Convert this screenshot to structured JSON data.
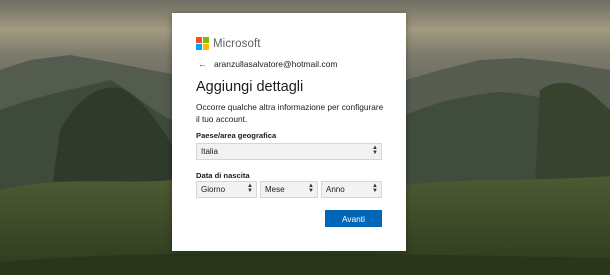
{
  "brand": {
    "name": "Microsoft",
    "colors": {
      "red": "#f25022",
      "green": "#7fba00",
      "blue": "#00a4ef",
      "yellow": "#ffb900"
    }
  },
  "account": {
    "back_icon": "arrow-left-icon",
    "email": "aranzullasalvatore@hotmail.com"
  },
  "page": {
    "title": "Aggiungi dettagli",
    "description": "Occorre qualche altra informazione per configurare il tuo account."
  },
  "form": {
    "country_label": "Paese/area geografica",
    "country_value": "Italia",
    "dob_label": "Data di nascita",
    "day_value": "Giorno",
    "month_value": "Mese",
    "year_value": "Anno"
  },
  "actions": {
    "next_label": "Avanti",
    "accent_color": "#0067b8"
  }
}
